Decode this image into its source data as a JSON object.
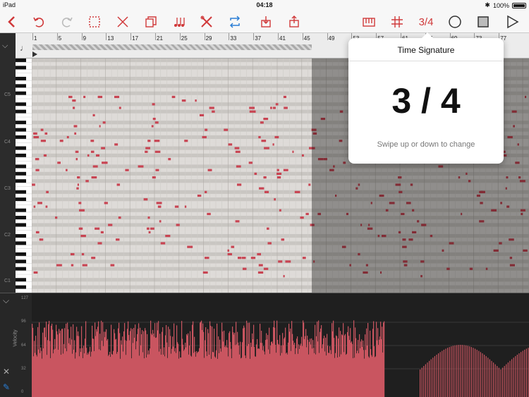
{
  "status": {
    "device": "iPad",
    "time": "04:18",
    "battery": "100%"
  },
  "toolbar": {
    "time_signature_button": "3/4"
  },
  "ruler": {
    "bar_labels": [
      "1",
      "5",
      "9",
      "13",
      "17",
      "21",
      "25",
      "29",
      "33",
      "37",
      "41",
      "45",
      "49",
      "53",
      "57",
      "61",
      "65",
      "69",
      "73",
      "77"
    ]
  },
  "piano": {
    "octave_labels": [
      "C5",
      "C4",
      "C3",
      "C2",
      "C1"
    ]
  },
  "velocity": {
    "title": "Velocity",
    "ticks": [
      "127",
      "96",
      "64",
      "32",
      "0"
    ]
  },
  "popover": {
    "title": "Time Signature",
    "value": "3 / 4",
    "hint": "Swipe up or down to change"
  },
  "colors": {
    "accent": "#d0393a",
    "note": "#c84452",
    "velocity_bar": "#c95560"
  }
}
